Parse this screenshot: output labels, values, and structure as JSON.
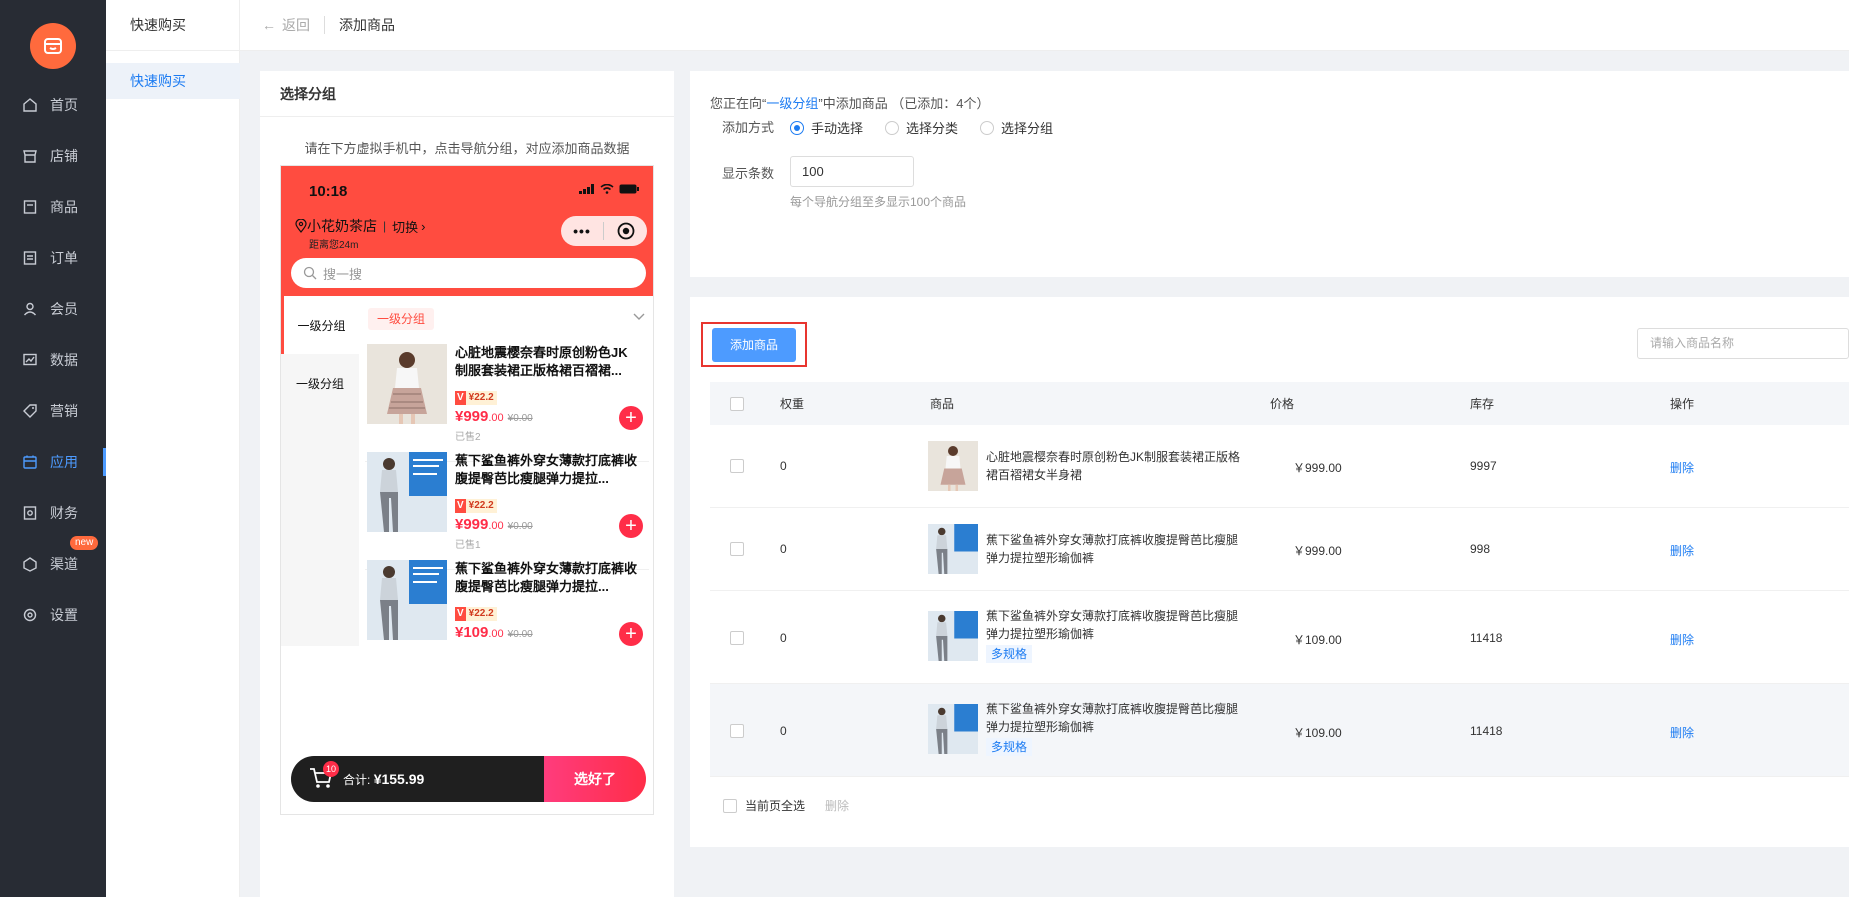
{
  "sidebar": {
    "items": [
      {
        "label": "首页",
        "icon": "home-icon"
      },
      {
        "label": "店铺",
        "icon": "shop-icon"
      },
      {
        "label": "商品",
        "icon": "goods-icon"
      },
      {
        "label": "订单",
        "icon": "order-icon"
      },
      {
        "label": "会员",
        "icon": "member-icon"
      },
      {
        "label": "数据",
        "icon": "chart-icon"
      },
      {
        "label": "营销",
        "icon": "tag-icon"
      },
      {
        "label": "应用",
        "icon": "app-icon",
        "active": true
      },
      {
        "label": "财务",
        "icon": "finance-icon"
      },
      {
        "label": "渠道",
        "icon": "channel-icon",
        "badge": "new"
      },
      {
        "label": "设置",
        "icon": "gear-icon"
      }
    ]
  },
  "submenu": {
    "title": "快速购买",
    "item": "快速购买"
  },
  "topbar": {
    "back": "返回",
    "crumb": "添加商品"
  },
  "left_panel": {
    "title": "选择分组",
    "hint": "请在下方虚拟手机中，点击导航分组，对应添加商品数据",
    "phone": {
      "time": "10:18",
      "store": "小花奶茶店",
      "switch": "切换",
      "distance": "距离您24m",
      "capsule_dots": "•••",
      "search_placeholder": "搜一搜",
      "categories": [
        "一级分组",
        "一级分组"
      ],
      "tag": "一级分组",
      "products": [
        {
          "title": "心脏地震樱奈春时原创粉色JK制服套装裙正版格裙百褶裙...",
          "coupon": "¥22.2",
          "price": "¥999",
          "dec": ".00",
          "old": "¥0.00",
          "sold": "已售2"
        },
        {
          "title": "蕉下鲨鱼裤外穿女薄款打底裤收腹提臀芭比瘦腿弹力提拉...",
          "coupon": "¥22.2",
          "price": "¥999",
          "dec": ".00",
          "old": "¥0.00",
          "sold": "已售1"
        },
        {
          "title": "蕉下鲨鱼裤外穿女薄款打底裤收腹提臀芭比瘦腿弹力提拉...",
          "coupon": "¥22.2",
          "price": "¥109",
          "dec": ".00",
          "old": "¥0.00",
          "sold": ""
        }
      ],
      "cart": {
        "count": "10",
        "total_label": "合计:",
        "total": "¥155.99",
        "confirm": "选好了"
      }
    }
  },
  "settings": {
    "info_prefix": "您正在向“",
    "info_group": "一级分组",
    "info_suffix": "”中添加商品 （已添加：4个）",
    "method_label": "添加方式",
    "methods": [
      "手动选择",
      "选择分类",
      "选择分组"
    ],
    "count_label": "显示条数",
    "count_value": "100",
    "count_tip": "每个导航分组至多显示100个商品"
  },
  "table": {
    "add_button": "添加商品",
    "search_placeholder": "请输入商品名称",
    "headers": {
      "weight": "权重",
      "product": "商品",
      "price": "价格",
      "stock": "库存",
      "action": "操作"
    },
    "rows": [
      {
        "weight": "0",
        "name": "心脏地震樱奈春时原创粉色JK制服套装裙正版格裙百褶裙女半身裙",
        "multi": "",
        "price": "￥999.00",
        "stock": "9997",
        "action": "删除"
      },
      {
        "weight": "0",
        "name": "蕉下鲨鱼裤外穿女薄款打底裤收腹提臀芭比瘦腿弹力提拉塑形瑜伽裤",
        "multi": "",
        "price": "￥999.00",
        "stock": "998",
        "action": "删除"
      },
      {
        "weight": "0",
        "name": "蕉下鲨鱼裤外穿女薄款打底裤收腹提臀芭比瘦腿弹力提拉塑形瑜伽裤",
        "multi": "多规格",
        "price": "￥109.00",
        "stock": "11418",
        "action": "删除"
      },
      {
        "weight": "0",
        "name": "蕉下鲨鱼裤外穿女薄款打底裤收腹提臀芭比瘦腿弹力提拉塑形瑜伽裤",
        "multi": "多规格",
        "price": "￥109.00",
        "stock": "11418",
        "action": "删除"
      }
    ],
    "select_all": "当前页全选",
    "batch_delete": "删除"
  }
}
